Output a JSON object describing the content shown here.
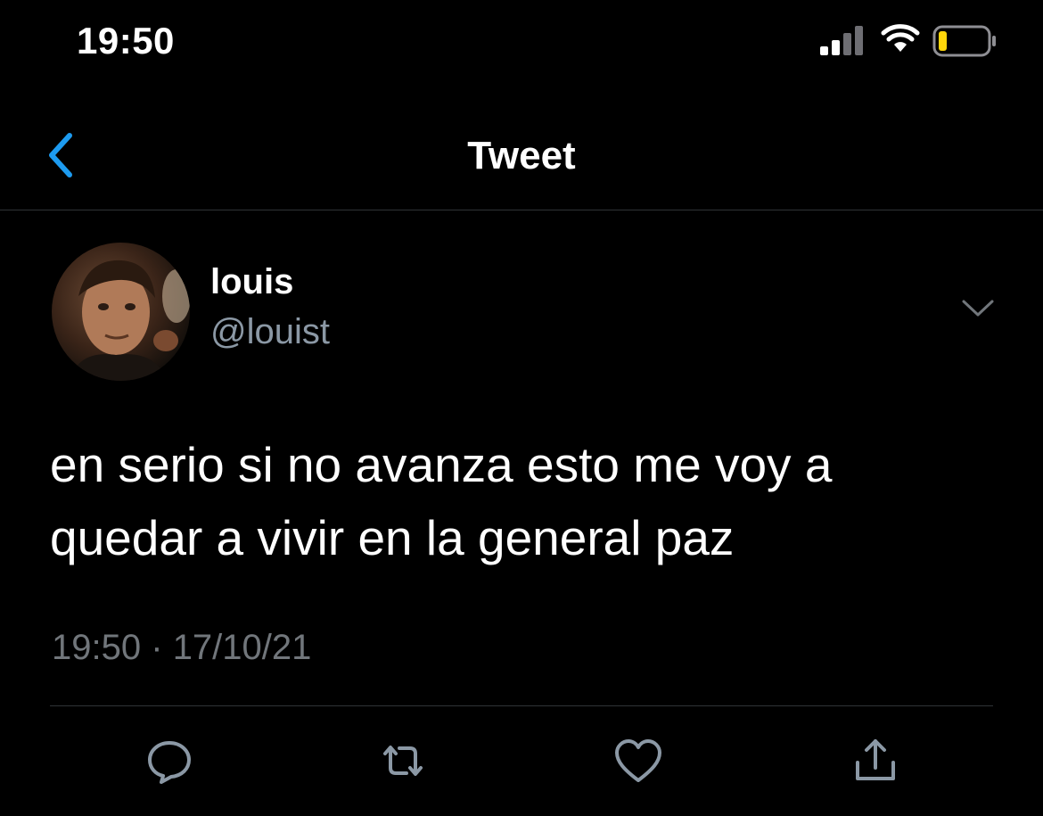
{
  "status_bar": {
    "time": "19:50",
    "icons": [
      "signal-icon",
      "wifi-icon",
      "battery-icon"
    ]
  },
  "nav": {
    "back_icon": "chevron-left-icon",
    "title": "Tweet"
  },
  "tweet": {
    "author": {
      "display_name": "louis",
      "handle": "@louist"
    },
    "text": "en serio si no avanza esto me voy a\nquedar a vivir en la general paz",
    "time": "19:50",
    "separator": "·",
    "date": "17/10/21"
  },
  "actions": [
    "reply-icon",
    "retweet-icon",
    "like-icon",
    "share-icon"
  ],
  "colors": {
    "background": "#000000",
    "accent": "#1d9bf0",
    "text_primary": "#ffffff",
    "text_secondary": "#8b98a5",
    "divider": "#2f3336",
    "battery_low": "#ffd60a"
  }
}
